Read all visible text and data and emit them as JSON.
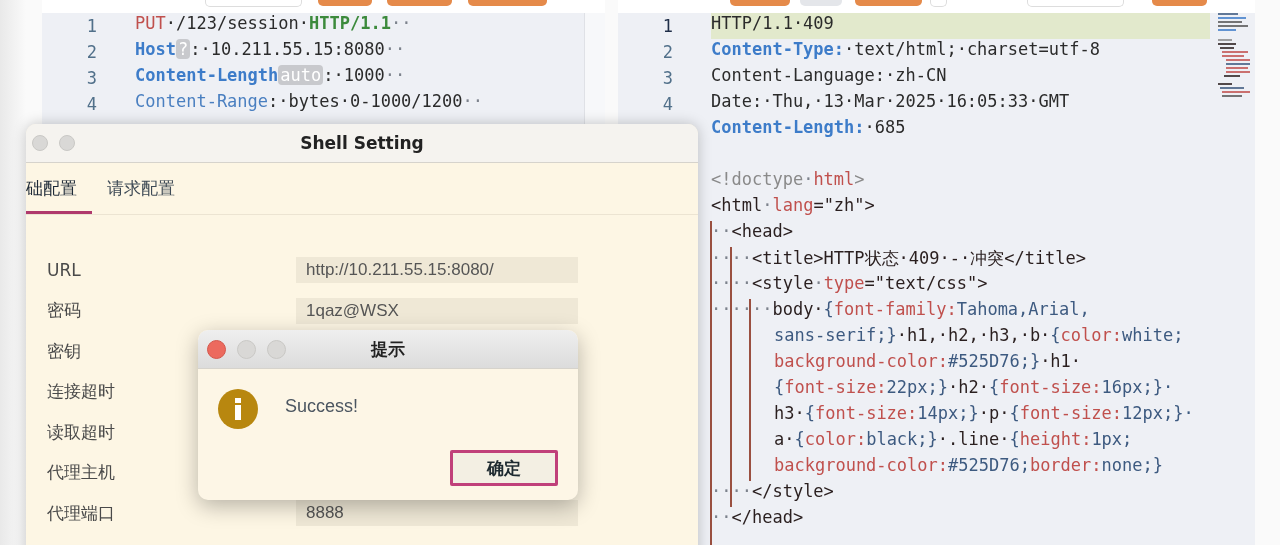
{
  "request_editor": {
    "lines": [
      {
        "number": "1",
        "tokens": [
          {
            "text": "PUT",
            "kind": "method"
          },
          {
            "text": "·/123/session·",
            "kind": "plain"
          },
          {
            "text": "HTTP/1.1",
            "kind": "version"
          },
          {
            "text": "··",
            "kind": "space"
          }
        ]
      },
      {
        "number": "2",
        "tokens": [
          {
            "text": "Host",
            "kind": "header"
          },
          {
            "text": "?",
            "kind": "badge"
          },
          {
            "text": ":·10.211.55.15:8080",
            "kind": "plain"
          },
          {
            "text": "··",
            "kind": "space"
          }
        ]
      },
      {
        "number": "3",
        "tokens": [
          {
            "text": "Content-Length",
            "kind": "header"
          },
          {
            "text": "auto",
            "kind": "badge"
          },
          {
            "text": ":·1000",
            "kind": "plain"
          },
          {
            "text": "··",
            "kind": "space"
          }
        ]
      },
      {
        "number": "4",
        "tokens": [
          {
            "text": "Content-Range",
            "kind": "header_light"
          },
          {
            "text": ":·bytes·0-1000/1200",
            "kind": "plain"
          },
          {
            "text": "··",
            "kind": "space"
          }
        ]
      }
    ]
  },
  "response_editor": {
    "lines": [
      {
        "kind": "line",
        "number": "1",
        "highlighted": true,
        "tokens": [
          {
            "text": "HTTP/1.1·409",
            "kind": "plain"
          }
        ]
      },
      {
        "kind": "line",
        "number": "2",
        "highlighted": false,
        "tokens": [
          {
            "text": "Content-Type:",
            "kind": "header"
          },
          {
            "text": "·text/html;·charset=utf-8",
            "kind": "plain"
          }
        ]
      },
      {
        "kind": "line",
        "number": "3",
        "highlighted": false,
        "tokens": [
          {
            "text": "Content-Language:·zh-CN",
            "kind": "plain"
          }
        ]
      },
      {
        "kind": "line",
        "number": "4",
        "highlighted": false,
        "tokens": [
          {
            "text": "Date:·Thu,·13·Mar·2025·16:05:33·GMT",
            "kind": "plain"
          }
        ]
      },
      {
        "kind": "line",
        "highlighted": false,
        "tokens": [
          {
            "text": "Content-Length:",
            "kind": "header"
          },
          {
            "text": "·685",
            "kind": "plain"
          }
        ]
      },
      {
        "kind": "blank",
        "highlighted": false
      },
      {
        "kind": "line",
        "highlighted": false,
        "tokens": [
          {
            "text": "<!doctype",
            "kind": "comment"
          },
          {
            "text": "·",
            "kind": "space"
          },
          {
            "text": "html",
            "kind": "attr"
          },
          {
            "text": ">",
            "kind": "comment"
          }
        ]
      },
      {
        "kind": "line",
        "highlighted": false,
        "tokens": [
          {
            "text": "<html",
            "kind": "tag"
          },
          {
            "text": "·",
            "kind": "space"
          },
          {
            "text": "lang",
            "kind": "attr"
          },
          {
            "text": "=\"zh\">",
            "kind": "tag"
          }
        ]
      },
      {
        "kind": "line",
        "highlighted": false,
        "tokens": [
          {
            "text": "··",
            "kind": "space"
          },
          {
            "text": "<head>",
            "kind": "tag"
          }
        ]
      },
      {
        "kind": "line",
        "highlighted": false,
        "tokens": [
          {
            "text": "····",
            "kind": "space"
          },
          {
            "text": "<title>HTTP状态·409·-·冲突</title>",
            "kind": "tag"
          }
        ]
      },
      {
        "kind": "line",
        "highlighted": false,
        "tokens": [
          {
            "text": "····",
            "kind": "space"
          },
          {
            "text": "<style",
            "kind": "tag"
          },
          {
            "text": "·",
            "kind": "space"
          },
          {
            "text": "type",
            "kind": "attr"
          },
          {
            "text": "=\"text/css\">",
            "kind": "tag"
          }
        ]
      },
      {
        "kind": "line",
        "highlighted": false,
        "tokens": [
          {
            "text": "······",
            "kind": "space"
          },
          {
            "text": "body·",
            "kind": "tag"
          },
          {
            "text": "{",
            "kind": "value"
          },
          {
            "text": "font-family:",
            "kind": "attr"
          },
          {
            "text": "Tahoma,Arial,",
            "kind": "value"
          }
        ]
      },
      {
        "kind": "wrap",
        "highlighted": false,
        "tokens": [
          {
            "text": "sans-serif;}",
            "kind": "value"
          },
          {
            "text": "·h1,·h2,·h3,·b·",
            "kind": "tag"
          },
          {
            "text": "{",
            "kind": "value"
          },
          {
            "text": "color:",
            "kind": "attr"
          },
          {
            "text": "white;",
            "kind": "value"
          }
        ]
      },
      {
        "kind": "wrap",
        "highlighted": false,
        "tokens": [
          {
            "text": "background-color:",
            "kind": "attr"
          },
          {
            "text": "#525D76;}",
            "kind": "value"
          },
          {
            "text": "·h1·",
            "kind": "tag"
          }
        ]
      },
      {
        "kind": "wrap",
        "highlighted": false,
        "tokens": [
          {
            "text": "{",
            "kind": "value"
          },
          {
            "text": "font-size:",
            "kind": "attr"
          },
          {
            "text": "22px;}",
            "kind": "value"
          },
          {
            "text": "·h2·",
            "kind": "tag"
          },
          {
            "text": "{",
            "kind": "value"
          },
          {
            "text": "font-size:",
            "kind": "attr"
          },
          {
            "text": "16px;}·",
            "kind": "value"
          }
        ]
      },
      {
        "kind": "wrap",
        "highlighted": false,
        "tokens": [
          {
            "text": "h3·",
            "kind": "tag"
          },
          {
            "text": "{",
            "kind": "value"
          },
          {
            "text": "font-size:",
            "kind": "attr"
          },
          {
            "text": "14px;}",
            "kind": "value"
          },
          {
            "text": "·p·",
            "kind": "tag"
          },
          {
            "text": "{",
            "kind": "value"
          },
          {
            "text": "font-size:",
            "kind": "attr"
          },
          {
            "text": "12px;}·",
            "kind": "value"
          }
        ]
      },
      {
        "kind": "wrap",
        "highlighted": false,
        "tokens": [
          {
            "text": "a·",
            "kind": "tag"
          },
          {
            "text": "{",
            "kind": "value"
          },
          {
            "text": "color:",
            "kind": "attr"
          },
          {
            "text": "black;}",
            "kind": "value"
          },
          {
            "text": "·.line·",
            "kind": "tag"
          },
          {
            "text": "{",
            "kind": "value"
          },
          {
            "text": "height:",
            "kind": "attr"
          },
          {
            "text": "1px;",
            "kind": "value"
          }
        ]
      },
      {
        "kind": "wrap",
        "highlighted": false,
        "tokens": [
          {
            "text": "background-color:",
            "kind": "attr"
          },
          {
            "text": "#525D76;",
            "kind": "value"
          },
          {
            "text": "border:",
            "kind": "attr"
          },
          {
            "text": "none;}",
            "kind": "value"
          }
        ]
      },
      {
        "kind": "line",
        "highlighted": false,
        "tokens": [
          {
            "text": "····",
            "kind": "space"
          },
          {
            "text": "</style>",
            "kind": "tag"
          }
        ]
      },
      {
        "kind": "line",
        "highlighted": false,
        "tokens": [
          {
            "text": "··",
            "kind": "space"
          },
          {
            "text": "</head>",
            "kind": "tag"
          }
        ]
      }
    ]
  },
  "shell_setting": {
    "title": "Shell Setting",
    "active": false,
    "tabs": [
      {
        "label": "础配置",
        "selected": true
      },
      {
        "label": "请求配置",
        "selected": false
      }
    ],
    "fields": [
      {
        "label": "URL",
        "value": "http://10.211.55.15:8080/"
      },
      {
        "label": "密码",
        "value": "1qaz@WSX"
      },
      {
        "label": "密钥"
      },
      {
        "label": "连接超时"
      },
      {
        "label": "读取超时"
      },
      {
        "label": "代理主机"
      },
      {
        "label": "代理端口",
        "value": "8888"
      }
    ]
  },
  "alert": {
    "title": "提示",
    "active": true,
    "message": "Success!",
    "button": {
      "label": "确定",
      "focused": true
    }
  }
}
